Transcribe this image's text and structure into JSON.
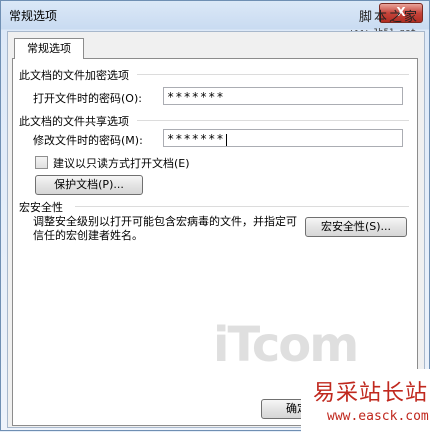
{
  "window": {
    "title": "常规选项",
    "close_label": "X"
  },
  "watermarks": {
    "top": "脚本之家",
    "top_url": "www.Jb51.net",
    "itcom": "iTcom",
    "bottom": "易采站长站",
    "bottom_url": "www.easck.com"
  },
  "tab": {
    "label": "常规选项"
  },
  "encrypt_group": {
    "title": "此文档的文件加密选项",
    "open_password_label": "打开文件时的密码(O):",
    "open_password_value": "*******"
  },
  "share_group": {
    "title": "此文档的文件共享选项",
    "modify_password_label": "修改文件时的密码(M):",
    "modify_password_value": "*******",
    "readonly_checkbox_label": "建议以只读方式打开文档(E)",
    "readonly_checked": false,
    "protect_button_label": "保护文档(P)..."
  },
  "macro_group": {
    "title": "宏安全性",
    "description": "调整安全级别以打开可能包含宏病毒的文件，并指定可信任的宏创建者姓名。",
    "macro_button_label": "宏安全性(S)..."
  },
  "footer": {
    "ok_label": "确定"
  }
}
